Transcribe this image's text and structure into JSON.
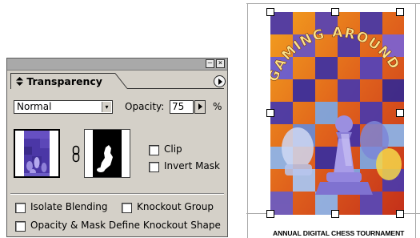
{
  "transparency_panel": {
    "title": "Transparency",
    "title_icon": "up-down-arrows",
    "window_buttons": {
      "minimize": "–",
      "close": "×"
    },
    "blend_mode": {
      "value": "Normal",
      "options_arrow": "▾"
    },
    "opacity": {
      "label": "Opacity:",
      "value": "75",
      "unit": "%"
    },
    "clip_label": "Clip",
    "invert_mask_label": "Invert Mask",
    "isolate_blending_label": "Isolate Blending",
    "knockout_group_label": "Knockout Group",
    "opacity_mask_label": "Opacity & Mask Define Knockout Shape",
    "checkboxes": {
      "clip": false,
      "invert_mask": false,
      "isolate_blending": false,
      "knockout_group": false,
      "opacity_mask_knockout": false
    }
  },
  "poster": {
    "headline": "GAMING AROUND",
    "caption": "ANNUAL DIGITAL CHESS TOURNAMENT",
    "colors": {
      "orange": "#f09a1c",
      "red_orange": "#d9521a",
      "purple": "#4e3aa8",
      "light_blue": "#7fa6de",
      "yellow": "#f6d84a"
    }
  }
}
